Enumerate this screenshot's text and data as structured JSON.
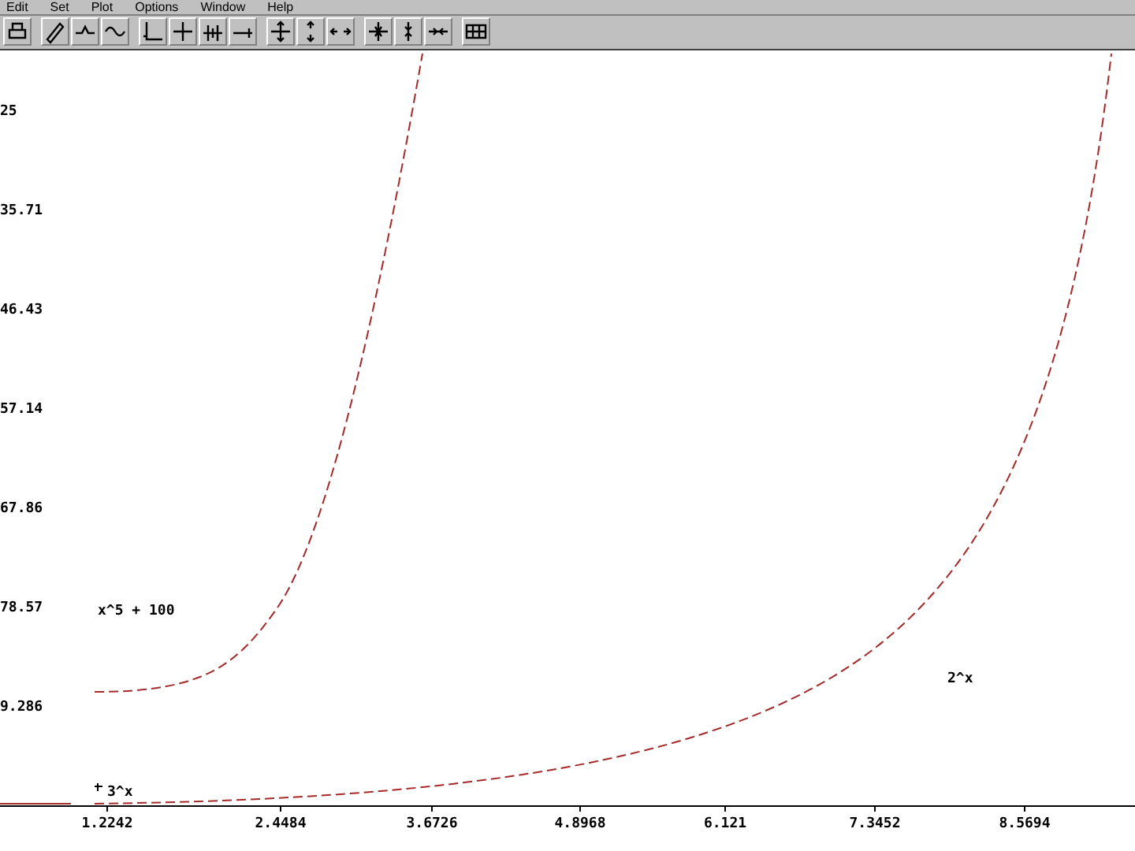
{
  "menu_bar": [
    "Edit",
    "Set",
    "Plot",
    "Options",
    "Window",
    "Help"
  ],
  "plot": {
    "y_axis_labels": [
      "25",
      "35.71",
      "46.43",
      "57.14",
      "67.86",
      "78.57",
      "9.286"
    ],
    "x_axis_labels": [
      "1.2242",
      "2.4484",
      "3.6726",
      "4.8968",
      "6.121",
      "7.3452",
      "8.5694"
    ],
    "curves": [
      {
        "kind": "power",
        "label": "x^5 + 100"
      },
      {
        "kind": "exp2",
        "label": "2^x"
      },
      {
        "kind": "exp3",
        "label": "3^x"
      }
    ]
  }
}
